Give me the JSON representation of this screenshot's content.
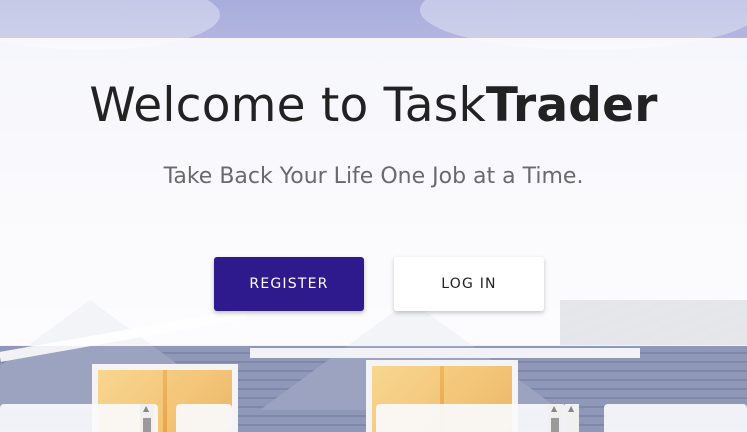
{
  "hero": {
    "title_prefix": "Welcome to Task",
    "title_emphasis": "Trader",
    "subtitle": "Take Back Your Life One Job at a Time."
  },
  "actions": {
    "register_label": "REGISTER",
    "login_label": "LOG IN"
  },
  "colors": {
    "primary": "#2e1a8c",
    "hero_overlay": "#ffffff",
    "title_text": "#222222",
    "subtitle_text": "#6a6a6a"
  },
  "icons": {
    "scroll_up": "scroll-up-arrow-icon"
  }
}
